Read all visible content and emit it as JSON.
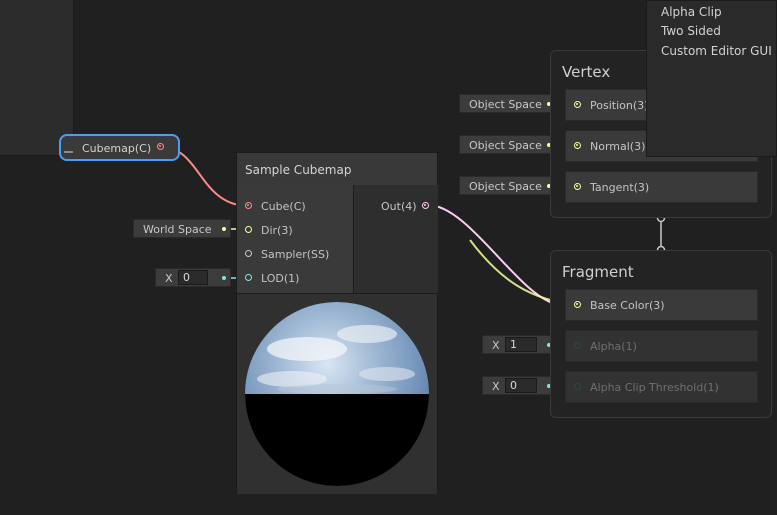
{
  "colors": {
    "canvas_bg": "#202020",
    "texture_port": "#ff8a8a",
    "vector3_port": "#f6ff9a",
    "vector1_port": "#84e4e7",
    "sampler_port": "#c8c8c8",
    "vector4_port": "#fbcbf4",
    "selection": "#4a9ff5"
  },
  "property_node": {
    "label": "Cubemap(C)",
    "port_icon": "texture-port-icon"
  },
  "sample_cubemap": {
    "title": "Sample Cubemap",
    "inputs": [
      {
        "label": "Cube(C)",
        "type": "texture"
      },
      {
        "label": "Dir(3)",
        "type": "vector3"
      },
      {
        "label": "Sampler(SS)",
        "type": "sampler"
      },
      {
        "label": "LOD(1)",
        "type": "vector1"
      }
    ],
    "outputs": [
      {
        "label": "Out(4)",
        "type": "vector4"
      }
    ],
    "inline": {
      "dir_value": "World Space",
      "lod_axis": "X",
      "lod_value": "0"
    }
  },
  "vertex_stack": {
    "title": "Vertex",
    "blocks": [
      {
        "label": "Position(3)",
        "inline_value": "Object Space"
      },
      {
        "label": "Normal(3)",
        "inline_value": "Object Space"
      },
      {
        "label": "Tangent(3)",
        "inline_value": "Object Space"
      }
    ]
  },
  "fragment_stack": {
    "title": "Fragment",
    "blocks": [
      {
        "label": "Base Color(3)",
        "connected": true
      },
      {
        "label": "Alpha(1)",
        "inline_axis": "X",
        "inline_value": "1",
        "dimmed": true
      },
      {
        "label": "Alpha Clip Threshold(1)",
        "inline_axis": "X",
        "inline_value": "0",
        "dimmed": true
      }
    ]
  },
  "settings_menu": {
    "items": [
      "Alpha Clip",
      "Two Sided",
      "Custom Editor GUI"
    ]
  }
}
